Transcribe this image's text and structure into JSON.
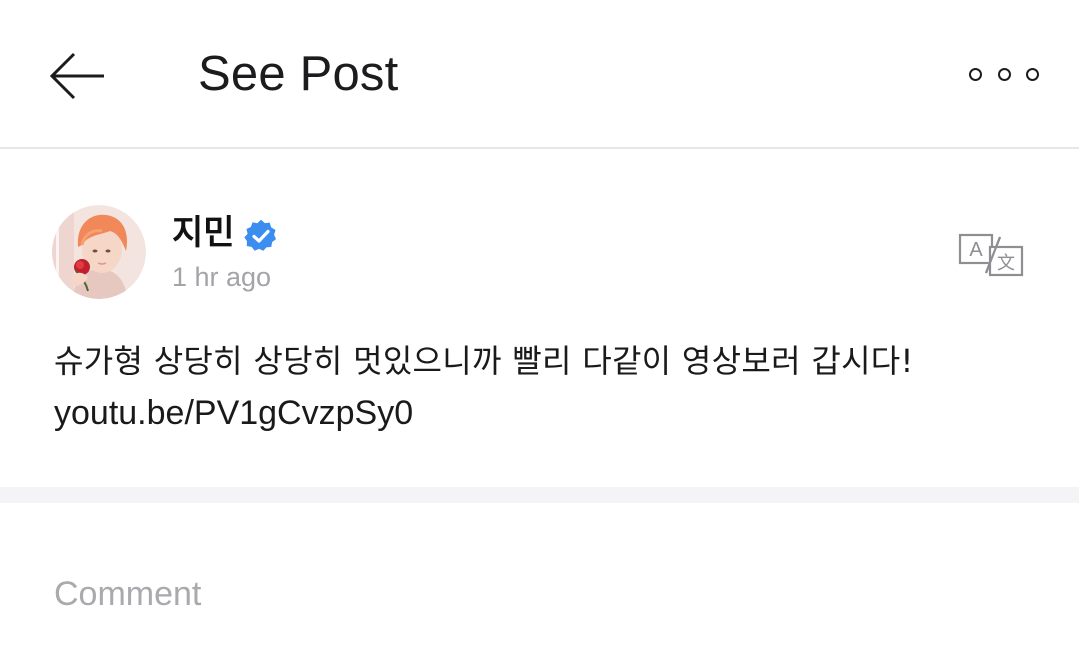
{
  "header": {
    "title": "See Post",
    "back_icon": "arrow-left-icon",
    "more_icon": "more-horizontal-icon"
  },
  "post": {
    "author": "지민",
    "verified_icon": "verified-badge-icon",
    "verified_color": "#3b8ef0",
    "timestamp": "1 hr ago",
    "translate_icon": "translate-icon",
    "text": "슈가형 상당히 상당히 멋있으니까 빨리 다같이 영상보러 갑시다!",
    "link": "youtu.be/PV1gCvzpSy0"
  },
  "comment": {
    "placeholder": "Comment",
    "value": ""
  }
}
